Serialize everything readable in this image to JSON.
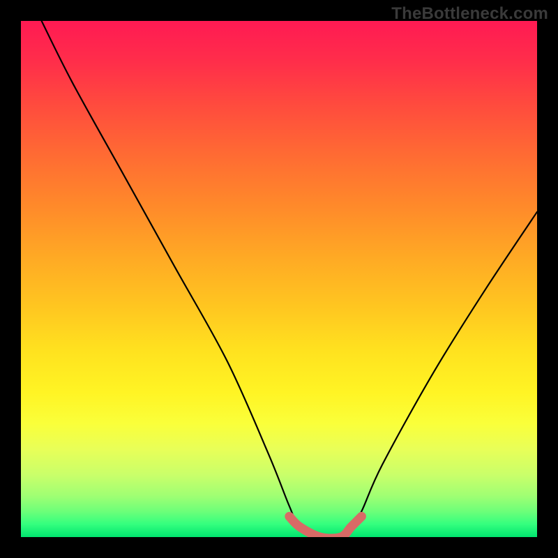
{
  "watermark": "TheBottleneck.com",
  "chart_data": {
    "type": "line",
    "title": "",
    "xlabel": "",
    "ylabel": "",
    "xlim": [
      0,
      100
    ],
    "ylim": [
      0,
      100
    ],
    "x": [
      4,
      10,
      20,
      30,
      40,
      48,
      52,
      54,
      58,
      62,
      64,
      66,
      70,
      80,
      90,
      100
    ],
    "series": [
      {
        "name": "curve",
        "values": [
          100,
          88,
          70,
          52,
          34,
          16,
          6,
          2,
          0,
          0,
          2,
          5,
          14,
          32,
          48,
          63
        ]
      }
    ],
    "optimal_band": {
      "x_start": 52,
      "x_end": 66,
      "y": 0
    },
    "gradient_stops": [
      {
        "pct": 0,
        "color": "#ff1a53"
      },
      {
        "pct": 50,
        "color": "#ffc820"
      },
      {
        "pct": 80,
        "color": "#f5ff40"
      },
      {
        "pct": 100,
        "color": "#00e56f"
      }
    ]
  }
}
